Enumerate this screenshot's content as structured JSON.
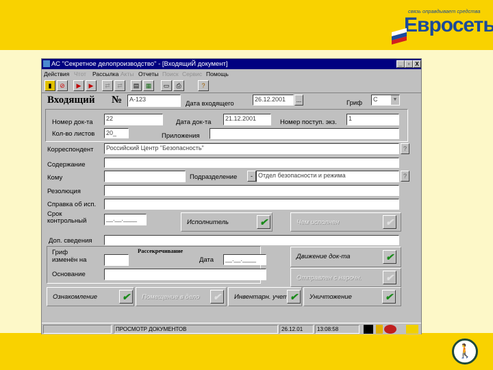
{
  "branding": {
    "slogan": "связь оправдывает средства",
    "brand": "Евросеть",
    "flag_colors": [
      "#ffffff",
      "#1a4aa0",
      "#d02020"
    ]
  },
  "window": {
    "title": "АС \"Секретное делопроизводство\" - [ВходящиЙ документ]",
    "controls": [
      "_",
      "▫",
      "X"
    ]
  },
  "menu": [
    {
      "label": "Действия",
      "enabled": true
    },
    {
      "label": "Чтот",
      "enabled": false
    },
    {
      "label": "Рассылка",
      "enabled": true
    },
    {
      "label": "Акты",
      "enabled": false
    },
    {
      "label": "Отчеты",
      "enabled": true
    },
    {
      "label": "Поиск",
      "enabled": false
    },
    {
      "label": "Сервис",
      "enabled": false
    },
    {
      "label": "Помощь",
      "enabled": true
    }
  ],
  "toolbar": [
    "exit-icon",
    "cancel-icon",
    "send-icon",
    "forward-icon",
    "move-left-icon",
    "move-right-icon",
    "copy-icon",
    "paste-icon",
    "document-icon",
    "print-icon",
    "help-icon"
  ],
  "form": {
    "heading": "Входящий",
    "number_sign": "№",
    "number": "A-123",
    "date_in_label": "Дата входящего",
    "date_in": "26.12.2001",
    "date_btn": "...",
    "grif_label": "Гриф",
    "grif": "C",
    "doc_num_label": "Номер док-та",
    "doc_num": "22",
    "doc_date_label": "Дата док-та",
    "doc_date": "21.12.2001",
    "copy_num_label": "Номер поступ. экз.",
    "copy_num": "1",
    "sheets_label": "Кол-во  листов",
    "sheets": "20_",
    "attach_label": "Приложения",
    "attach": "",
    "correspondent_label": "Корреспондент",
    "correspondent": "Российский Центр \"Безопасность\"",
    "content_label": "Содержание",
    "content": "",
    "to_label": "Кому",
    "to": "",
    "dept_label": "Подразделение",
    "dept_btn": "-",
    "dept": "Отдел безопасности и режима",
    "help_btn": "?",
    "resolution_label": "Резолюция",
    "resolution": "",
    "report_label": "Справка об исп.",
    "report": "",
    "deadline_label1": "Срок",
    "deadline_label2": "контрольный",
    "deadline": "__.__.____",
    "executor": "Исполнитель",
    "executed_by": "Чем исполнен",
    "extra_label": "Доп. сведения",
    "extra": "",
    "declass_title": "Рассекречивание",
    "grif_changed1": "Гриф",
    "grif_changed2": "изменён на",
    "grif_changed": "",
    "declass_date_label": "Дата",
    "declass_date": "__.__.____",
    "basis_label": "Основание",
    "basis": "",
    "movement": "Движение док-та",
    "sent_courier": "Отправлен с нарочн.",
    "familiarization": "Ознакомление",
    "file_placement": "Помещение в дело",
    "inventory": "Инвентарн. учет",
    "destruction": "Уничтожение"
  },
  "status": {
    "mode": "ПРОСМОТР ДОКУМЕНТОВ",
    "date": "26.12.01",
    "time": "13:08:58"
  }
}
